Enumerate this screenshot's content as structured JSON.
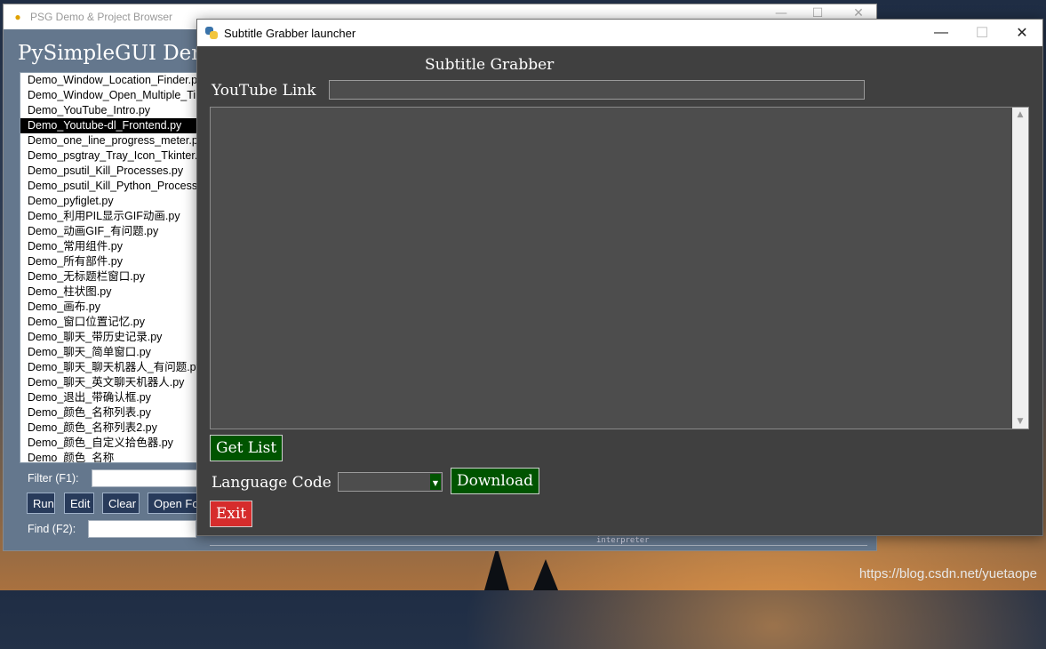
{
  "desktop": {
    "watermark": "https://blog.csdn.net/yuetaope"
  },
  "back_window": {
    "title": "PSG Demo & Project Browser",
    "heading": "PySimpleGUI Demo",
    "files": [
      "Demo_Window_Location_Finder.py",
      "Demo_Window_Open_Multiple_Times.py",
      "Demo_YouTube_Intro.py",
      "Demo_Youtube-dl_Frontend.py",
      "Demo_one_line_progress_meter.py",
      "Demo_psgtray_Tray_Icon_Tkinter.py",
      "Demo_psutil_Kill_Processes.py",
      "Demo_psutil_Kill_Python_Processes.py",
      "Demo_pyfiglet.py",
      "Demo_利用PIL显示GIF动画.py",
      "Demo_动画GIF_有问题.py",
      "Demo_常用组件.py",
      "Demo_所有部件.py",
      "Demo_无标题栏窗口.py",
      "Demo_柱状图.py",
      "Demo_画布.py",
      "Demo_窗口位置记忆.py",
      "Demo_聊天_带历史记录.py",
      "Demo_聊天_简单窗口.py",
      "Demo_聊天_聊天机器人_有问题.py",
      "Demo_聊天_英文聊天机器人.py",
      "Demo_退出_带确认框.py",
      "Demo_颜色_名称列表.py",
      "Demo_颜色_名称列表2.py",
      "Demo_颜色_自定义拾色器.py",
      "Demo_颜色_名称"
    ],
    "selected_file": "Demo_Youtube-dl_Frontend.py",
    "filter_label": "Filter (F1):",
    "find_label": "Find (F2):",
    "buttons": {
      "run": "Run",
      "edit": "Edit",
      "clear": "Clear",
      "open_folder": "Open Folder"
    },
    "interpreter_text": "interpreter"
  },
  "front_window": {
    "title": "Subtitle Grabber launcher",
    "heading": "Subtitle Grabber",
    "youtube_label": "YouTube Link",
    "youtube_value": "",
    "output_text": "",
    "get_list_label": "Get List",
    "language_label": "Language Code",
    "language_value": "",
    "download_label": "Download",
    "exit_label": "Exit",
    "colors": {
      "background": "#404040",
      "button_green": "#005400",
      "button_red": "#d62c2c"
    }
  }
}
